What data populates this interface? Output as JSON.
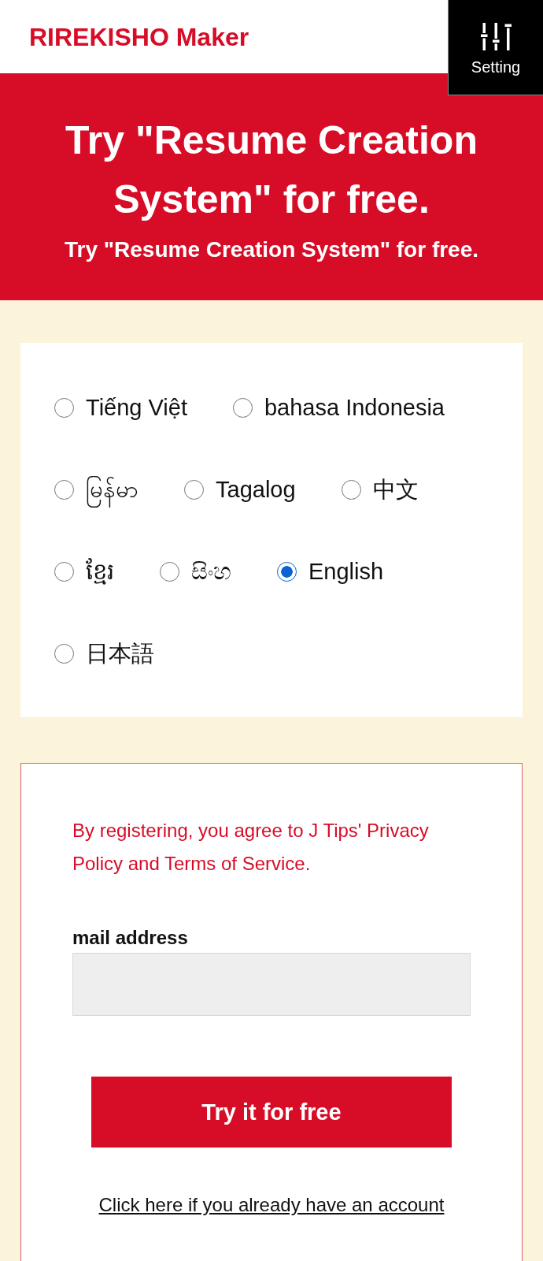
{
  "header": {
    "logo": "RIREKISHO Maker",
    "setting_button": {
      "label": "Setting"
    }
  },
  "banner": {
    "title": "Try \"Resume Creation System\" for free.",
    "subtitle": "Try \"Resume Creation System\" for free."
  },
  "languages": [
    {
      "label": "Tiếng Việt",
      "selected": false
    },
    {
      "label": "bahasa Indonesia",
      "selected": false
    },
    {
      "label": "မြန်မာ",
      "selected": false
    },
    {
      "label": "Tagalog",
      "selected": false
    },
    {
      "label": "中文",
      "selected": false
    },
    {
      "label": "ខ្មែរ",
      "selected": false
    },
    {
      "label": "සිංහ",
      "selected": false
    },
    {
      "label": "English",
      "selected": true
    },
    {
      "label": "日本語",
      "selected": false
    }
  ],
  "signup": {
    "notice": "By registering, you agree to J Tips' Privacy Policy and Terms of Service.",
    "email_field": {
      "label": "mail address"
    },
    "submit_button": "Try it for free",
    "login_link": "Click here if you already have an account"
  }
}
